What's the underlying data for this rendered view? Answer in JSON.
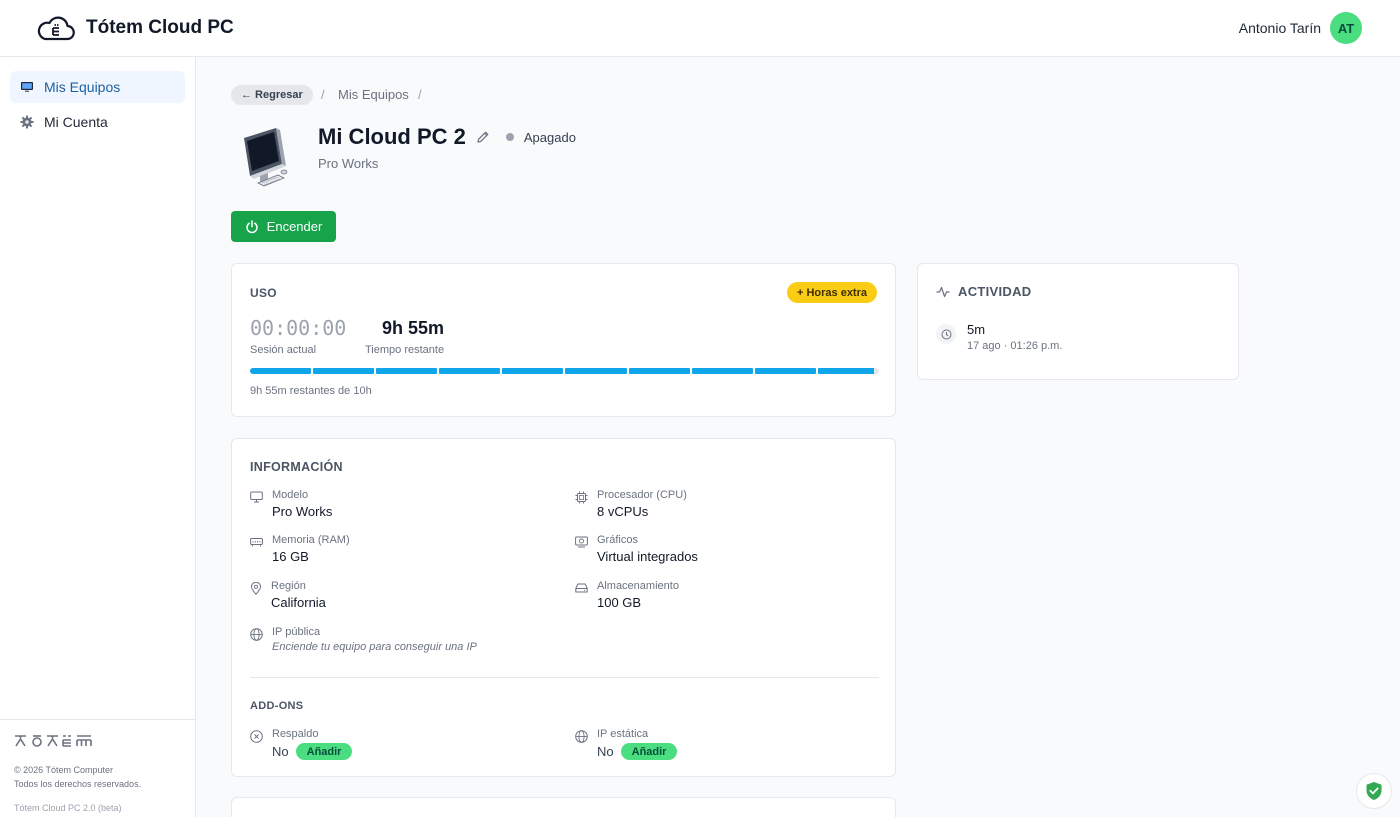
{
  "header": {
    "brand_title": "Tótem Cloud PC",
    "user_name": "Antonio Tarín",
    "avatar_initials": "AT"
  },
  "sidebar": {
    "items": [
      {
        "label": "Mis Equipos",
        "icon": "monitor-icon",
        "active": true
      },
      {
        "label": "Mi Cuenta",
        "icon": "gear-icon",
        "active": false
      }
    ],
    "footer": {
      "logo_text": "TOTEM",
      "copyright": "© 2026 Tótem Computer",
      "rights": "Todos los derechos reservados.",
      "version": "Tótem Cloud PC 2.0 (beta)"
    }
  },
  "breadcrumb": {
    "back_label": "← Regresar",
    "current": "Mis Equipos"
  },
  "device": {
    "name": "Mi Cloud PC 2",
    "status": "Apagado",
    "plan": "Pro Works",
    "power_label": "Encender"
  },
  "usage": {
    "title": "USO",
    "extra_hours_label": "+ Horas extra",
    "session_time": "00:00:00",
    "session_label": "Sesión actual",
    "remaining_time": "9h 55m",
    "remaining_label": "Tiempo restante",
    "remaining_fraction": 0.992,
    "note": "9h 55m restantes de 10h"
  },
  "activity": {
    "title": "ACTIVIDAD",
    "entries": [
      {
        "value": "5m",
        "time": "17 ago · 01:26 p.m."
      }
    ]
  },
  "info": {
    "title": "INFORMACIÓN",
    "specs": [
      {
        "label": "Modelo",
        "value": "Pro Works",
        "icon": "monitor-icon"
      },
      {
        "label": "Procesador (CPU)",
        "value": "8 vCPUs",
        "icon": "cpu-icon"
      },
      {
        "label": "Memoria (RAM)",
        "value": "16 GB",
        "icon": "memory-icon"
      },
      {
        "label": "Gráficos",
        "value": "Virtual integrados",
        "icon": "gpu-icon"
      },
      {
        "label": "Región",
        "value": "California",
        "icon": "location-icon"
      },
      {
        "label": "Almacenamiento",
        "value": "100 GB",
        "icon": "storage-icon"
      },
      {
        "label": "IP pública",
        "value": "Enciende tu equipo para conseguir una IP",
        "icon": "globe-icon"
      }
    ],
    "addons_title": "ADD-ONS",
    "addons": [
      {
        "label": "Respaldo",
        "value": "No",
        "button": "Añadir",
        "icon": "backup-icon"
      },
      {
        "label": "IP estática",
        "value": "No",
        "button": "Añadir",
        "icon": "globe-icon"
      }
    ]
  },
  "colors": {
    "accent_green": "#16a34a",
    "add_green": "#4ade80",
    "progress_blue": "#0ea5e9",
    "extra_yellow": "#facc15",
    "active_nav": "#1e5f9e"
  }
}
